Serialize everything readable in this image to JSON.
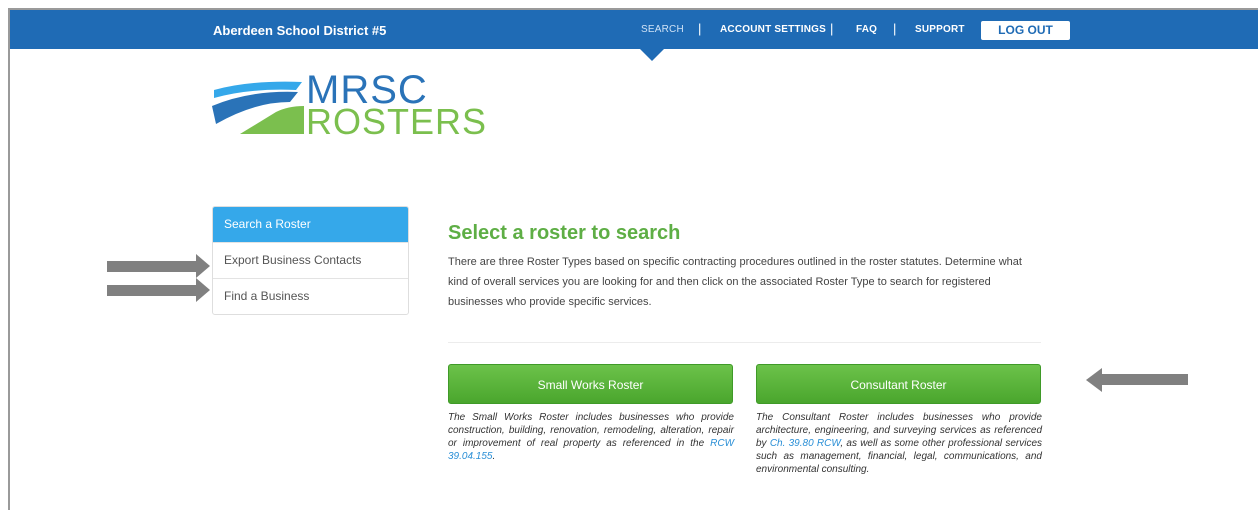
{
  "header": {
    "brand": "Aberdeen School District #5",
    "nav": [
      {
        "label": "SEARCH",
        "active": true
      },
      {
        "label": "ACCOUNT SETTINGS",
        "active": false
      },
      {
        "label": "FAQ",
        "active": false
      },
      {
        "label": "SUPPORT",
        "active": false
      }
    ],
    "separator": "|",
    "logout": "LOG OUT"
  },
  "logo": {
    "line1": "MRSC",
    "line2": "ROSTERS",
    "colors": {
      "blue": "#2a73b8",
      "green": "#7bbf4e"
    }
  },
  "sidebar": {
    "items": [
      {
        "label": "Search a Roster",
        "active": true
      },
      {
        "label": "Export Business Contacts",
        "active": false
      },
      {
        "label": "Find a Business",
        "active": false
      }
    ]
  },
  "main": {
    "title": "Select a roster to search",
    "intro": "There are three Roster Types based on specific contracting procedures outlined in the roster statutes. Determine what kind of overall services you are looking for and then click on the associated Roster Type to search for registered businesses who provide specific services.",
    "small_works": {
      "button": "Small Works Roster",
      "desc": "The Small Works Roster includes businesses who provide construction, building, renovation, remodeling, alteration, repair or improvement of real property as referenced in the",
      "link": "RCW 39.04.155",
      "desc_end": "."
    },
    "consultant": {
      "button": "Consultant Roster",
      "desc_start": "The Consultant Roster includes businesses who provide architecture, engineering, and surveying services as referenced by",
      "link": "Ch. 39.80 RCW",
      "desc_end": ", as well as some other professional services such as management, financial, legal, communications, and environmental consulting."
    }
  },
  "colors": {
    "header_bg": "#1f6bb5",
    "active_tab": "#35a8ea",
    "accent_green": "#5eae45",
    "annotation_arrow": "#808080"
  }
}
